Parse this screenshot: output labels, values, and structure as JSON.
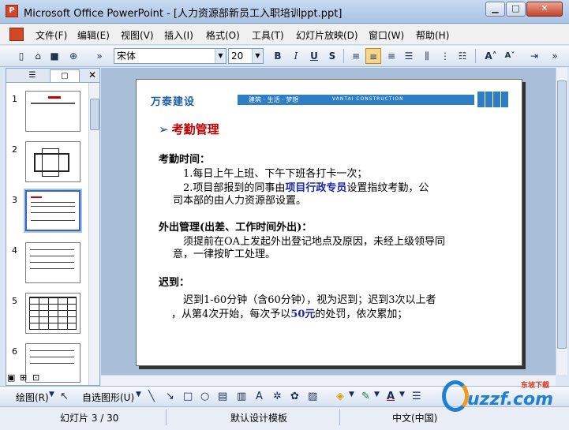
{
  "window": {
    "title": "Microsoft Office PowerPoint - [人力资源部新员工入职培训ppt.ppt]",
    "app_icon": "P"
  },
  "menu": [
    "文件(F)",
    "编辑(E)",
    "视图(V)",
    "插入(I)",
    "格式(O)",
    "工具(T)",
    "幻灯片放映(D)",
    "窗口(W)",
    "帮助(H)"
  ],
  "toolbar": {
    "font": "宋体",
    "size": "20"
  },
  "thumbnails": [
    "1",
    "2",
    "3",
    "4",
    "5",
    "6"
  ],
  "slide": {
    "banner_logo": "万泰建设",
    "banner_motto": "建筑 · 生活 · 梦想",
    "banner_en": "VANTAI CONSTRUCTION",
    "heading": "考勤管理",
    "section1_title": "考勤时间：",
    "item1": "1.每日上午上班、下午下班各打卡一次；",
    "item2_pre": "2.项目部报到的同事由",
    "item2_hl": "项目行政专员",
    "item2_post": "设置指纹考勤，公",
    "item2_line2": "司本部的由人力资源部设置。",
    "section2_title": "外出管理(出差、工作时间外出)：",
    "out_line1": "须提前在OA上发起外出登记地点及原因，未经上级领导同",
    "out_line2": "意，一律按旷工处理。",
    "section3_title": "迟到：",
    "late_line1": "迟到1-60分钟（含60分钟），视为迟到；迟到3次以上者",
    "late_line2_pre": "，从第4次开始，每次予以",
    "late_line2_hl": "50元",
    "late_line2_post": "的处罚，依次累加；"
  },
  "drawbar": {
    "draw": "绘图(R)",
    "autoshapes": "自选图形(U)"
  },
  "status": {
    "slide": "幻灯片 3 / 30",
    "template": "默认设计模板",
    "lang": "中文(中国)"
  },
  "watermark": {
    "text": "uzzf.com",
    "sub": "东坡下载"
  }
}
